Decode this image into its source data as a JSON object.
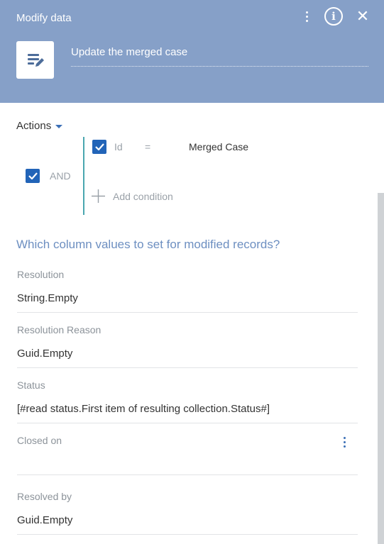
{
  "header": {
    "title": "Modify data",
    "element_name": "Update the merged case",
    "icons": [
      "more-vertical-icon",
      "info-icon",
      "close-icon",
      "edit-document-icon"
    ]
  },
  "actions": {
    "label": "Actions"
  },
  "filter": {
    "group_operator": "AND",
    "condition": {
      "column": "Id",
      "operator": "=",
      "value": "Merged Case"
    },
    "add_condition_label": "Add condition"
  },
  "section_title": "Which column values to set for modified records?",
  "fields": [
    {
      "label": "Resolution",
      "value": "String.Empty"
    },
    {
      "label": "Resolution Reason",
      "value": "Guid.Empty"
    },
    {
      "label": "Status",
      "value": "[#read status.First item of resulting collection.Status#]"
    },
    {
      "label": "Closed on",
      "value": ""
    },
    {
      "label": "Resolved by",
      "value": "Guid.Empty"
    }
  ],
  "colors": {
    "header_bg": "#86a0c8",
    "accent_blue": "#2264b8",
    "section_title": "#6d8fc1",
    "filter_line": "#4aa6b0"
  }
}
